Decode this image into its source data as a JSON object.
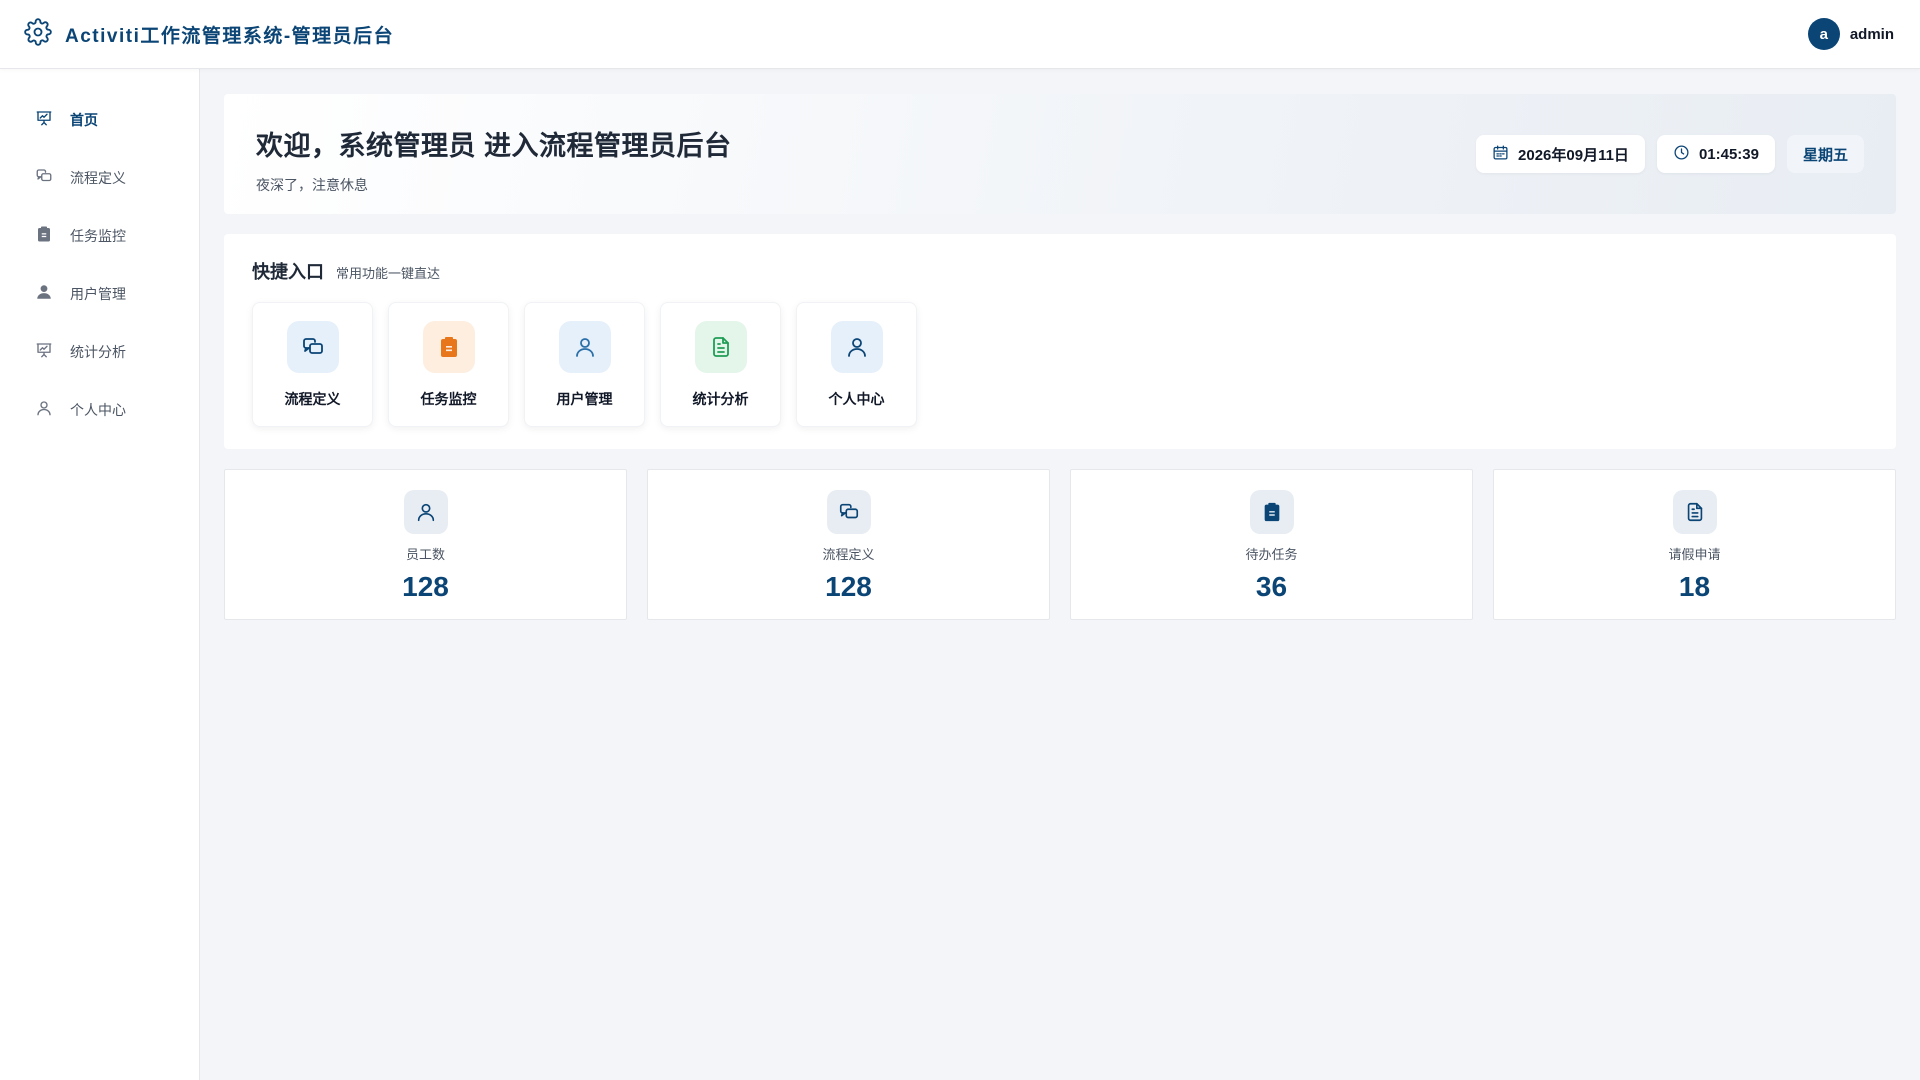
{
  "header": {
    "title": "Activiti工作流管理系统-管理员后台",
    "user": {
      "avatar_letter": "a",
      "name": "admin"
    },
    "icon": "gear-icon"
  },
  "sidebar": {
    "items": [
      {
        "label": "首页",
        "icon": "presentation-chart-icon",
        "active": true
      },
      {
        "label": "流程定义",
        "icon": "chat-bubbles-icon",
        "active": false
      },
      {
        "label": "任务监控",
        "icon": "clipboard-icon",
        "active": false
      },
      {
        "label": "用户管理",
        "icon": "user-solid-icon",
        "active": false
      },
      {
        "label": "统计分析",
        "icon": "presentation-chart-icon",
        "active": false
      },
      {
        "label": "个人中心",
        "icon": "user-outline-icon",
        "active": false
      }
    ]
  },
  "welcome": {
    "title": "欢迎，系统管理员 进入流程管理员后台",
    "subtitle": "夜深了，注意休息",
    "date": "2026年09月11日",
    "time": "01:45:39",
    "weekday": "星期五"
  },
  "quick": {
    "title": "快捷入口",
    "subtitle": "常用功能一键直达",
    "cards": [
      {
        "label": "流程定义",
        "icon": "chat-bubbles-icon",
        "color": "#0b4576",
        "bg": "#e6f0fa"
      },
      {
        "label": "任务监控",
        "icon": "clipboard-icon",
        "color": "#e8771c",
        "bg": "#fdeee0"
      },
      {
        "label": "用户管理",
        "icon": "user-outline-icon",
        "color": "#2a6fa8",
        "bg": "#e6f0fa"
      },
      {
        "label": "统计分析",
        "icon": "document-icon",
        "color": "#1f9d55",
        "bg": "#e4f5ea"
      },
      {
        "label": "个人中心",
        "icon": "user-outline-icon",
        "color": "#0b4576",
        "bg": "#e6f0fa"
      }
    ]
  },
  "stats": [
    {
      "label": "员工数",
      "value": "128",
      "icon": "user-outline-icon"
    },
    {
      "label": "流程定义",
      "value": "128",
      "icon": "chat-bubbles-icon"
    },
    {
      "label": "待办任务",
      "value": "36",
      "icon": "clipboard-icon"
    },
    {
      "label": "请假申请",
      "value": "18",
      "icon": "document-icon"
    }
  ],
  "colors": {
    "primary": "#0b4576",
    "background": "#f3f5f9"
  }
}
